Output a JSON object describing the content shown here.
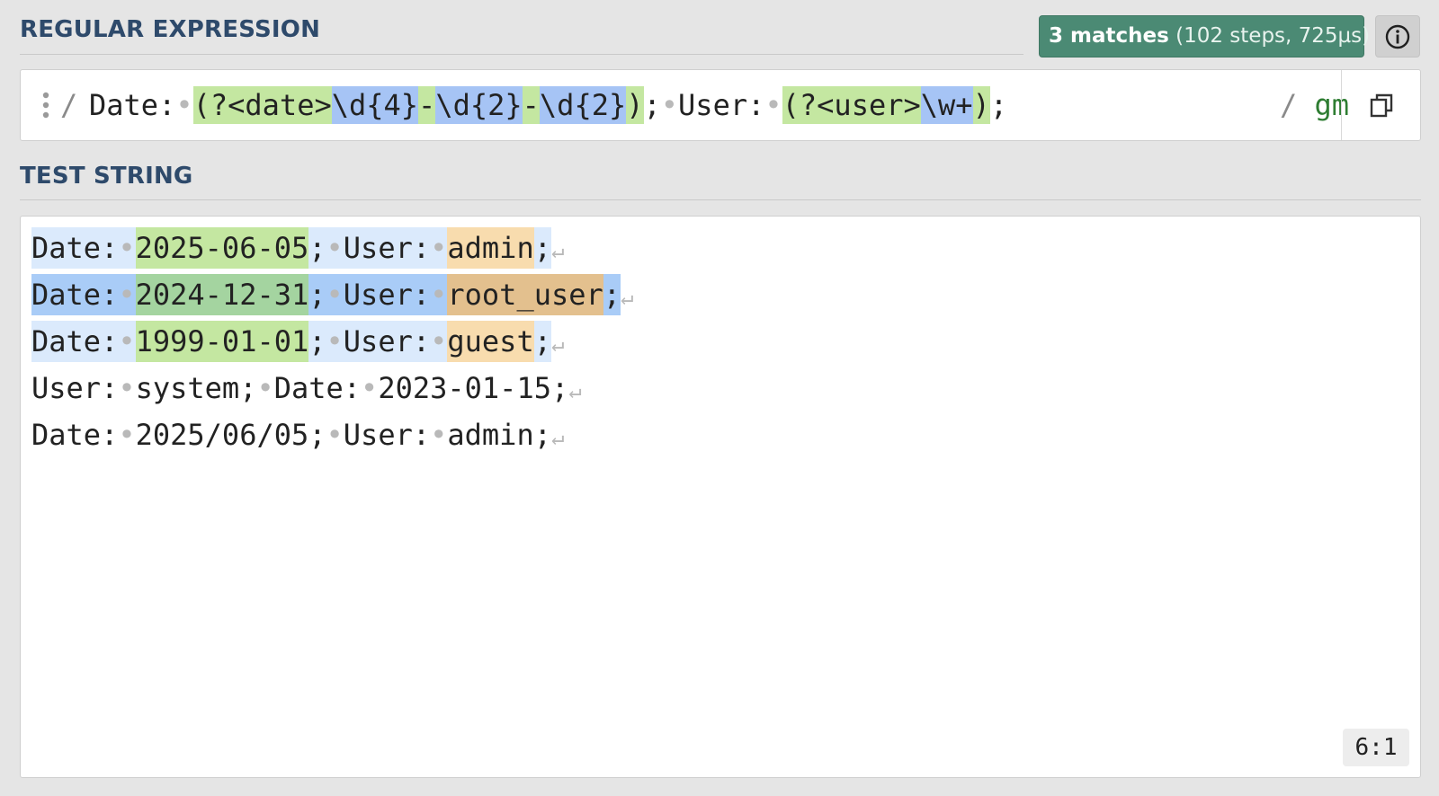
{
  "regex_section": {
    "title": "REGULAR EXPRESSION",
    "match_info": {
      "count_label": "3 matches",
      "detail_label": "(102 steps, 725µs)"
    },
    "delimiter_open": "/",
    "tokens": [
      {
        "text": "Date:",
        "kind": "lit"
      },
      {
        "text": "•",
        "kind": "space"
      },
      {
        "text": "(?<date>",
        "kind": "group"
      },
      {
        "text": "\\d{4}",
        "kind": "meta"
      },
      {
        "text": "-",
        "kind": "group"
      },
      {
        "text": "\\d{2}",
        "kind": "meta"
      },
      {
        "text": "-",
        "kind": "group"
      },
      {
        "text": "\\d{2}",
        "kind": "meta"
      },
      {
        "text": ")",
        "kind": "group"
      },
      {
        "text": ";",
        "kind": "lit"
      },
      {
        "text": "•",
        "kind": "space"
      },
      {
        "text": "User:",
        "kind": "lit"
      },
      {
        "text": "•",
        "kind": "space"
      },
      {
        "text": "(?<user>",
        "kind": "group"
      },
      {
        "text": "\\w+",
        "kind": "meta"
      },
      {
        "text": ")",
        "kind": "group"
      },
      {
        "text": ";",
        "kind": "lit"
      }
    ],
    "delimiter_close": "/",
    "flags": "gm",
    "icons": {
      "drag": "drag-handle-icon",
      "info": "info-icon",
      "copy": "copy-icon"
    }
  },
  "test_section": {
    "title": "TEST STRING",
    "newline_symbol": "↵",
    "lines": [
      [
        {
          "text": "Date:",
          "cls": "m-full"
        },
        {
          "text": "•",
          "cls": "m-full sp-dot"
        },
        {
          "text": "2025-06-05",
          "cls": "m-g1"
        },
        {
          "text": ";",
          "cls": "m-full"
        },
        {
          "text": "•",
          "cls": "m-full sp-dot"
        },
        {
          "text": "User:",
          "cls": "m-full"
        },
        {
          "text": "•",
          "cls": "m-full sp-dot"
        },
        {
          "text": "admin",
          "cls": "m-g2"
        },
        {
          "text": ";",
          "cls": "m-full"
        }
      ],
      [
        {
          "text": "Date:",
          "cls": "m-full-sel"
        },
        {
          "text": "•",
          "cls": "m-full-sel sp-dot"
        },
        {
          "text": "2024-12-31",
          "cls": "m-g1-sel"
        },
        {
          "text": ";",
          "cls": "m-full-sel"
        },
        {
          "text": "•",
          "cls": "m-full-sel sp-dot"
        },
        {
          "text": "User:",
          "cls": "m-full-sel"
        },
        {
          "text": "•",
          "cls": "m-full-sel sp-dot"
        },
        {
          "text": "root_user",
          "cls": "m-g2-sel"
        },
        {
          "text": ";",
          "cls": "m-full-sel"
        }
      ],
      [
        {
          "text": "Date:",
          "cls": "m-full"
        },
        {
          "text": "•",
          "cls": "m-full sp-dot"
        },
        {
          "text": "1999-01-01",
          "cls": "m-g1"
        },
        {
          "text": ";",
          "cls": "m-full"
        },
        {
          "text": "•",
          "cls": "m-full sp-dot"
        },
        {
          "text": "User:",
          "cls": "m-full"
        },
        {
          "text": "•",
          "cls": "m-full sp-dot"
        },
        {
          "text": "guest",
          "cls": "m-g2"
        },
        {
          "text": ";",
          "cls": "m-full"
        }
      ],
      [
        {
          "text": "User:",
          "cls": ""
        },
        {
          "text": "•",
          "cls": "sp-dot"
        },
        {
          "text": "system;",
          "cls": ""
        },
        {
          "text": "•",
          "cls": "sp-dot"
        },
        {
          "text": "Date:",
          "cls": ""
        },
        {
          "text": "•",
          "cls": "sp-dot"
        },
        {
          "text": "2023-01-15;",
          "cls": ""
        }
      ],
      [
        {
          "text": "Date:",
          "cls": ""
        },
        {
          "text": "•",
          "cls": "sp-dot"
        },
        {
          "text": "2025/06/05;",
          "cls": ""
        },
        {
          "text": "•",
          "cls": "sp-dot"
        },
        {
          "text": "User:",
          "cls": ""
        },
        {
          "text": "•",
          "cls": "sp-dot"
        },
        {
          "text": "admin;",
          "cls": ""
        }
      ]
    ],
    "cursor_position": "6:1"
  },
  "colors": {
    "badge": "#4b8a74",
    "title": "#2e4a6b",
    "group_highlight": "#c4e7a1",
    "meta_highlight": "#a6c4f5",
    "match_highlight": "#dbeafc",
    "user_group_highlight": "#f8dcae",
    "flags": "#2e7d32"
  }
}
